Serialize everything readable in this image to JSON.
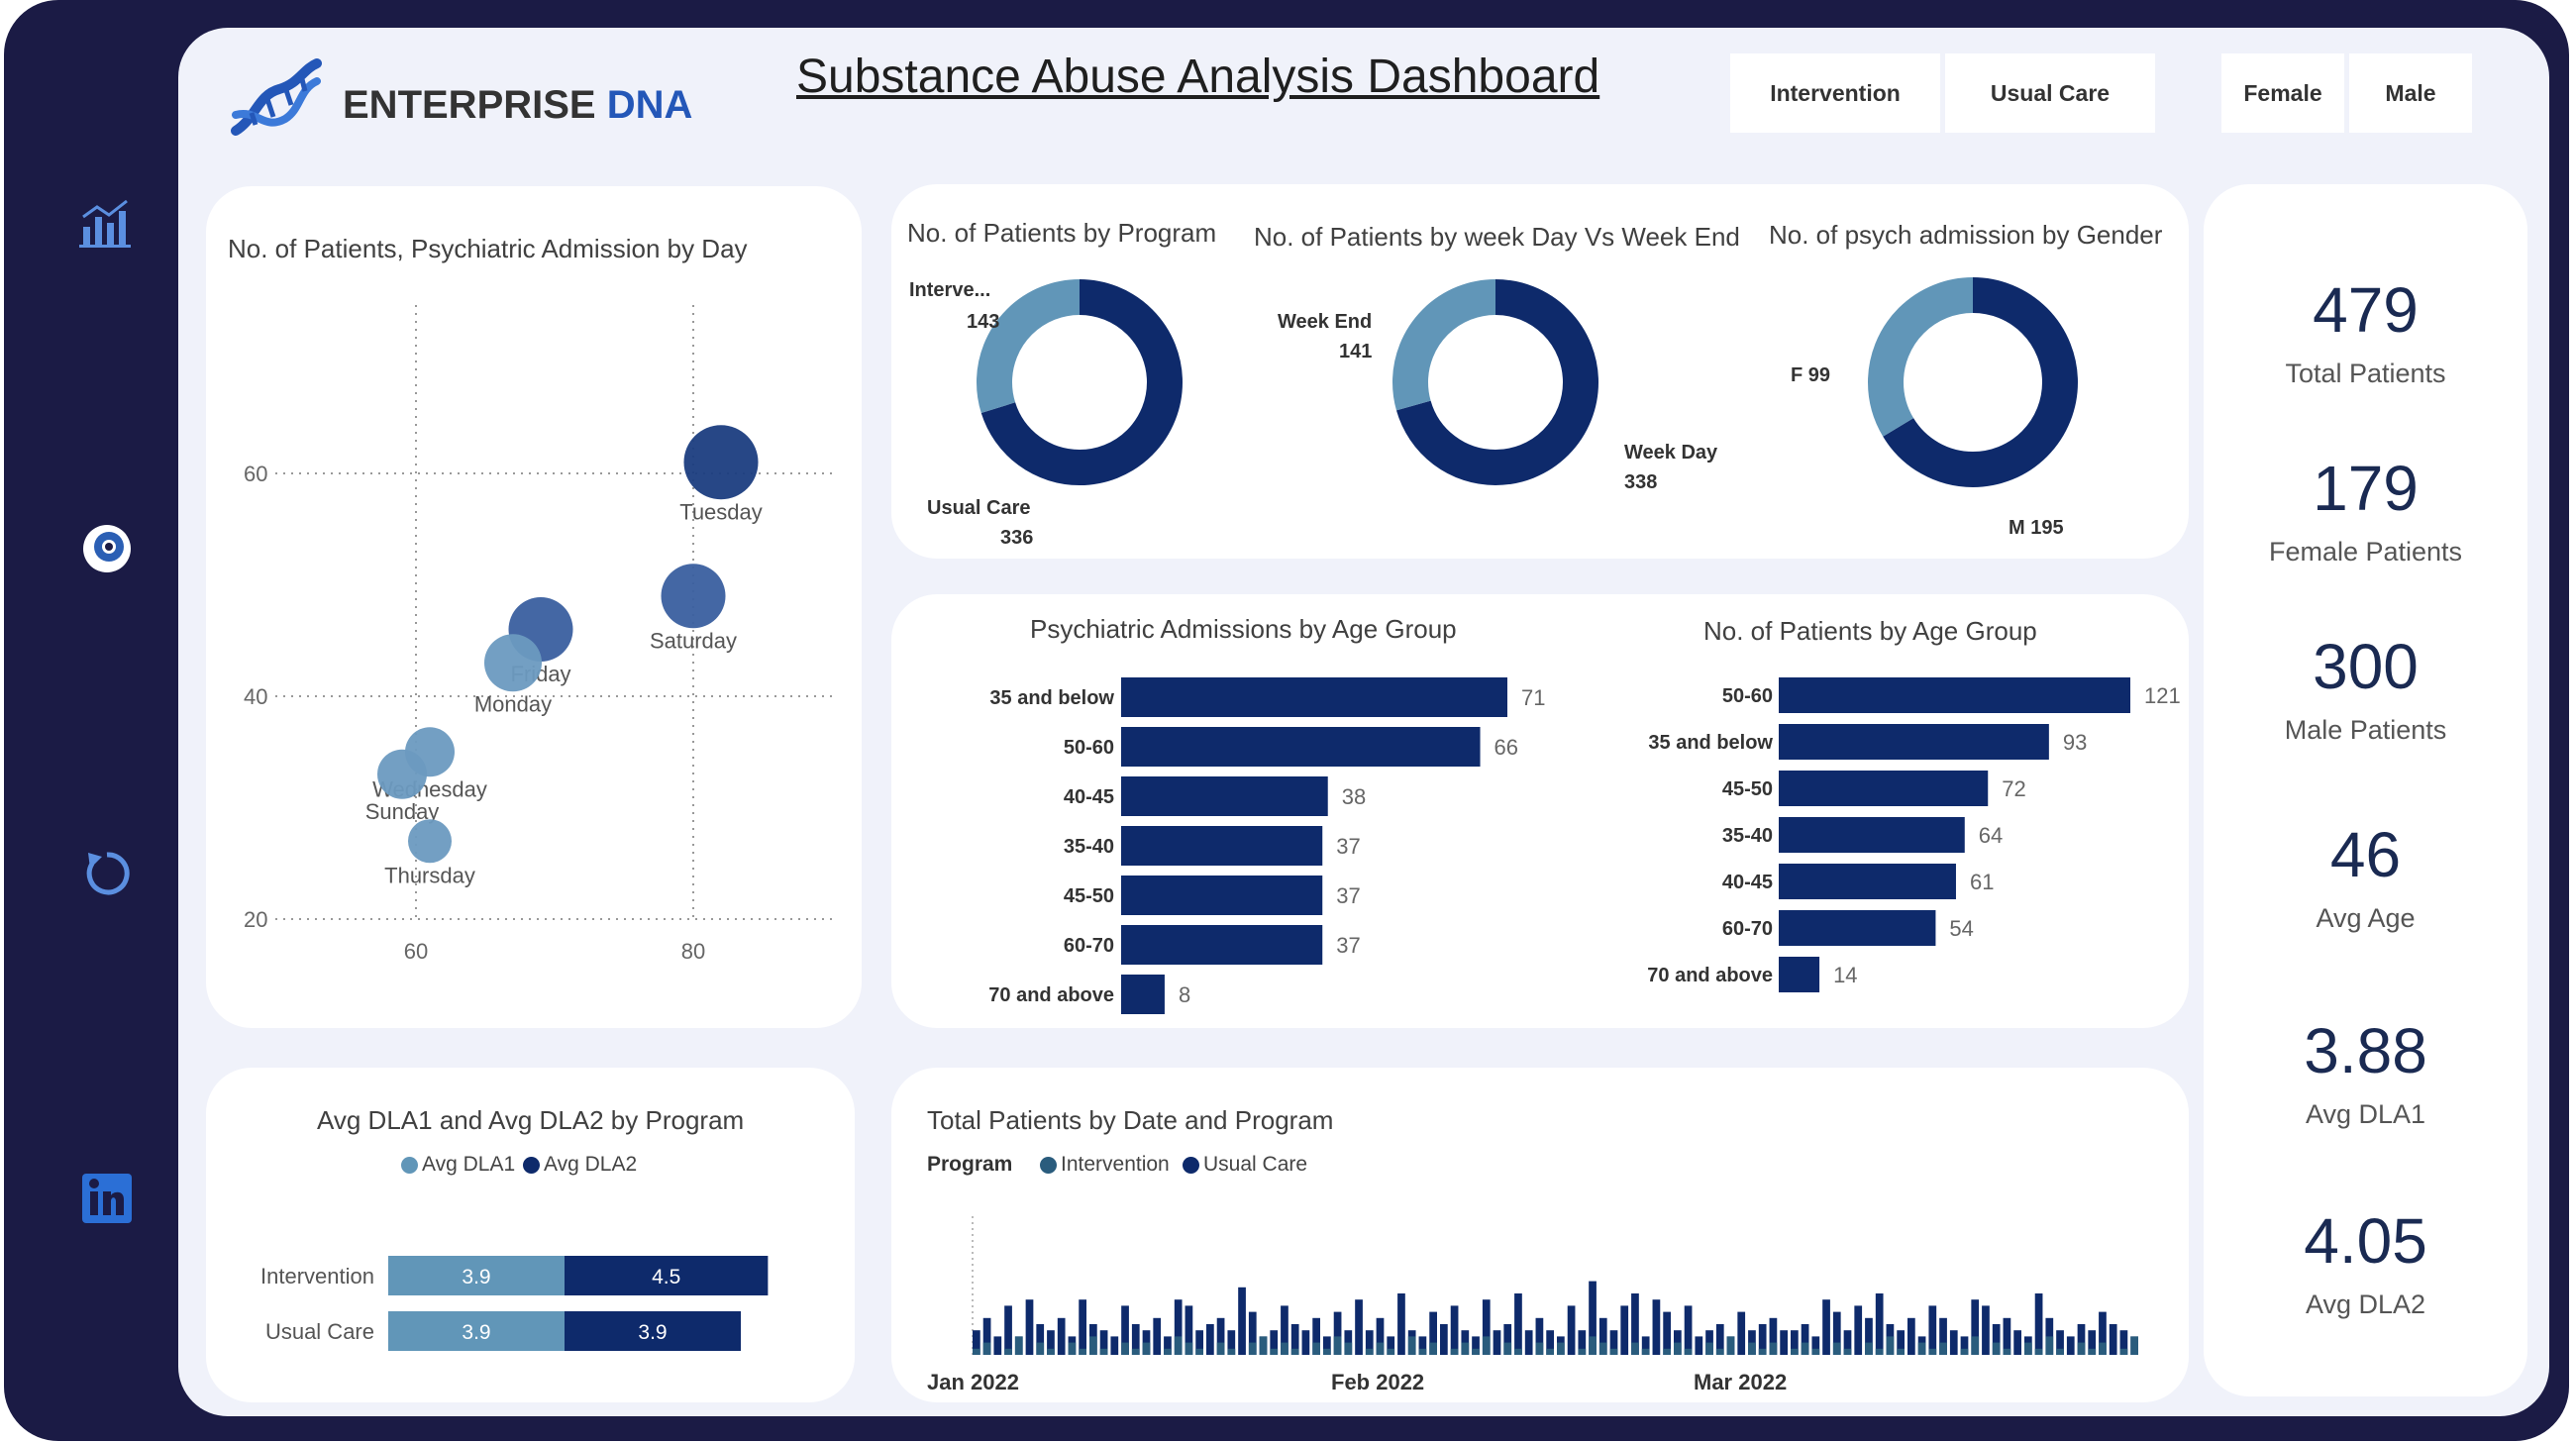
{
  "header": {
    "brand_name": "ENTERPRISE",
    "brand_suffix": "DNA",
    "title": "Substance Abuse Analysis Dashboard",
    "program_slicer": [
      "Intervention",
      "Usual Care"
    ],
    "gender_slicer": [
      "Female",
      "Male"
    ]
  },
  "sidebar": {
    "items": [
      {
        "icon": "bar-chart-icon"
      },
      {
        "icon": "eye-icon"
      },
      {
        "icon": "refresh-icon"
      },
      {
        "icon": "linkedin-icon"
      }
    ]
  },
  "colors": {
    "dark_navy": "#0e2a6b",
    "steel_blue": "#6196b8",
    "frame": "#1b1b45",
    "panel": "#f0f2fa"
  },
  "scatter": {
    "title": "No. of Patients, Psychiatric Admission by Day",
    "y_ticks": [
      "60",
      "40",
      "20"
    ],
    "x_ticks": [
      "60",
      "80"
    ]
  },
  "donuts": {
    "program": {
      "title": "No. of Patients by Program",
      "labels": [
        {
          "name": "Interve...",
          "value": "143"
        },
        {
          "name": "Usual Care",
          "value": "336"
        }
      ]
    },
    "weekday": {
      "title": "No. of Patients by week Day Vs Week End",
      "labels": [
        {
          "name": "Week End",
          "value": "141"
        },
        {
          "name": "Week Day",
          "value": "338"
        }
      ]
    },
    "gender": {
      "title": "No. of psych admission by Gender",
      "labels": [
        {
          "name": "F 99"
        },
        {
          "name": "M 195"
        }
      ]
    }
  },
  "kpis": [
    {
      "value": "479",
      "label": "Total Patients"
    },
    {
      "value": "179",
      "label": "Female Patients"
    },
    {
      "value": "300",
      "label": "Male Patients"
    },
    {
      "value": "46",
      "label": "Avg Age"
    },
    {
      "value": "3.88",
      "label": "Avg DLA1"
    },
    {
      "value": "4.05",
      "label": "Avg DLA2"
    }
  ],
  "dla": {
    "legend": [
      "Avg DLA1",
      "Avg DLA2"
    ],
    "rows": [
      {
        "label": "Intervention",
        "dla1_text": "3.9",
        "dla2_text": "4.5"
      },
      {
        "label": "Usual Care",
        "dla1_text": "3.9",
        "dla2_text": "3.9"
      }
    ]
  },
  "timeline": {
    "legend_title": "Program",
    "legend": [
      "Intervention",
      "Usual Care"
    ],
    "x_labels": [
      "Jan 2022",
      "Feb 2022",
      "Mar 2022"
    ]
  },
  "chart_data": [
    {
      "type": "scatter",
      "title": "No. of Patients, Psychiatric Admission by Day",
      "ylim": [
        20,
        65
      ],
      "xlim": [
        60,
        82
      ],
      "points": [
        {
          "label": "Tuesday",
          "x": 82,
          "y": 61,
          "size": 75
        },
        {
          "label": "Saturday",
          "x": 80,
          "y": 49,
          "size": 65
        },
        {
          "label": "Friday",
          "x": 69,
          "y": 46,
          "size": 65
        },
        {
          "label": "Monday",
          "x": 67,
          "y": 43,
          "size": 58
        },
        {
          "label": "Wednesday",
          "x": 61,
          "y": 35,
          "size": 50
        },
        {
          "label": "Sunday",
          "x": 59,
          "y": 33,
          "size": 50
        },
        {
          "label": "Thursday",
          "x": 61,
          "y": 27,
          "size": 44
        }
      ]
    },
    {
      "type": "pie",
      "title": "No. of Patients by Program",
      "categories": [
        "Intervention",
        "Usual Care"
      ],
      "values": [
        143,
        336
      ]
    },
    {
      "type": "pie",
      "title": "No. of Patients by week Day Vs Week End",
      "categories": [
        "Week End",
        "Week Day"
      ],
      "values": [
        141,
        338
      ]
    },
    {
      "type": "pie",
      "title": "No. of psych admission by Gender",
      "categories": [
        "F",
        "M"
      ],
      "values": [
        99,
        195
      ]
    },
    {
      "type": "bar",
      "title": "Psychiatric Admissions by Age Group",
      "categories": [
        "35 and below",
        "50-60",
        "40-45",
        "35-40",
        "45-50",
        "60-70",
        "70 and above"
      ],
      "values": [
        71,
        66,
        38,
        37,
        37,
        37,
        8
      ]
    },
    {
      "type": "bar",
      "title": "No. of Patients by Age Group",
      "categories": [
        "50-60",
        "35 and below",
        "45-50",
        "35-40",
        "40-45",
        "60-70",
        "70 and above"
      ],
      "values": [
        121,
        93,
        72,
        64,
        61,
        54,
        14
      ]
    },
    {
      "type": "bar",
      "title": "Avg DLA1 and Avg DLA2 by Program",
      "categories": [
        "Intervention",
        "Usual Care"
      ],
      "series": [
        {
          "name": "Avg DLA1",
          "values": [
            3.9,
            3.9
          ]
        },
        {
          "name": "Avg DLA2",
          "values": [
            4.5,
            3.9
          ]
        }
      ]
    },
    {
      "type": "bar",
      "title": "Total Patients by Date and Program",
      "x_labels": [
        "Jan 2022",
        "Feb 2022",
        "Mar 2022"
      ],
      "series": [
        {
          "name": "Intervention",
          "values": [
            1,
            2,
            0,
            1,
            3,
            0,
            2,
            1,
            0,
            2,
            1,
            3,
            1,
            0,
            2,
            1,
            2,
            0,
            1,
            3,
            2,
            1,
            0,
            2,
            1,
            0,
            2,
            3,
            1,
            2,
            1,
            0,
            2,
            1,
            3,
            2,
            0,
            1,
            2,
            1,
            0,
            3,
            1,
            2,
            0,
            1,
            2,
            1,
            3,
            0,
            2,
            1,
            0,
            2,
            1,
            2,
            0,
            1,
            3,
            2,
            1,
            0,
            2,
            1,
            0,
            1,
            2,
            1,
            0,
            2,
            1,
            3,
            0,
            2,
            1,
            2,
            0,
            1,
            2,
            1,
            0,
            2,
            1,
            0,
            2,
            1,
            3,
            1,
            0,
            2
          ]
        },
        {
          "name": "Usual Care",
          "values": [
            4,
            6,
            3,
            8,
            3,
            9,
            5,
            4,
            6,
            3,
            9,
            5,
            4,
            3,
            8,
            5,
            4,
            6,
            3,
            9,
            8,
            4,
            5,
            6,
            4,
            11,
            7,
            3,
            4,
            8,
            5,
            4,
            6,
            3,
            7,
            4,
            9,
            4,
            6,
            3,
            10,
            4,
            3,
            7,
            5,
            8,
            4,
            3,
            9,
            4,
            5,
            10,
            4,
            6,
            4,
            3,
            8,
            4,
            12,
            6,
            4,
            8,
            10,
            3,
            9,
            7,
            4,
            8,
            3,
            4,
            5,
            3,
            7,
            4,
            5,
            6,
            4,
            4,
            5,
            3,
            9,
            7,
            4,
            8,
            6,
            10,
            5,
            4,
            6,
            3,
            8,
            6,
            4,
            3,
            9,
            8,
            5,
            6,
            4,
            3,
            10,
            6,
            4,
            3,
            5,
            4,
            7,
            5,
            4,
            3
          ]
        }
      ]
    }
  ]
}
